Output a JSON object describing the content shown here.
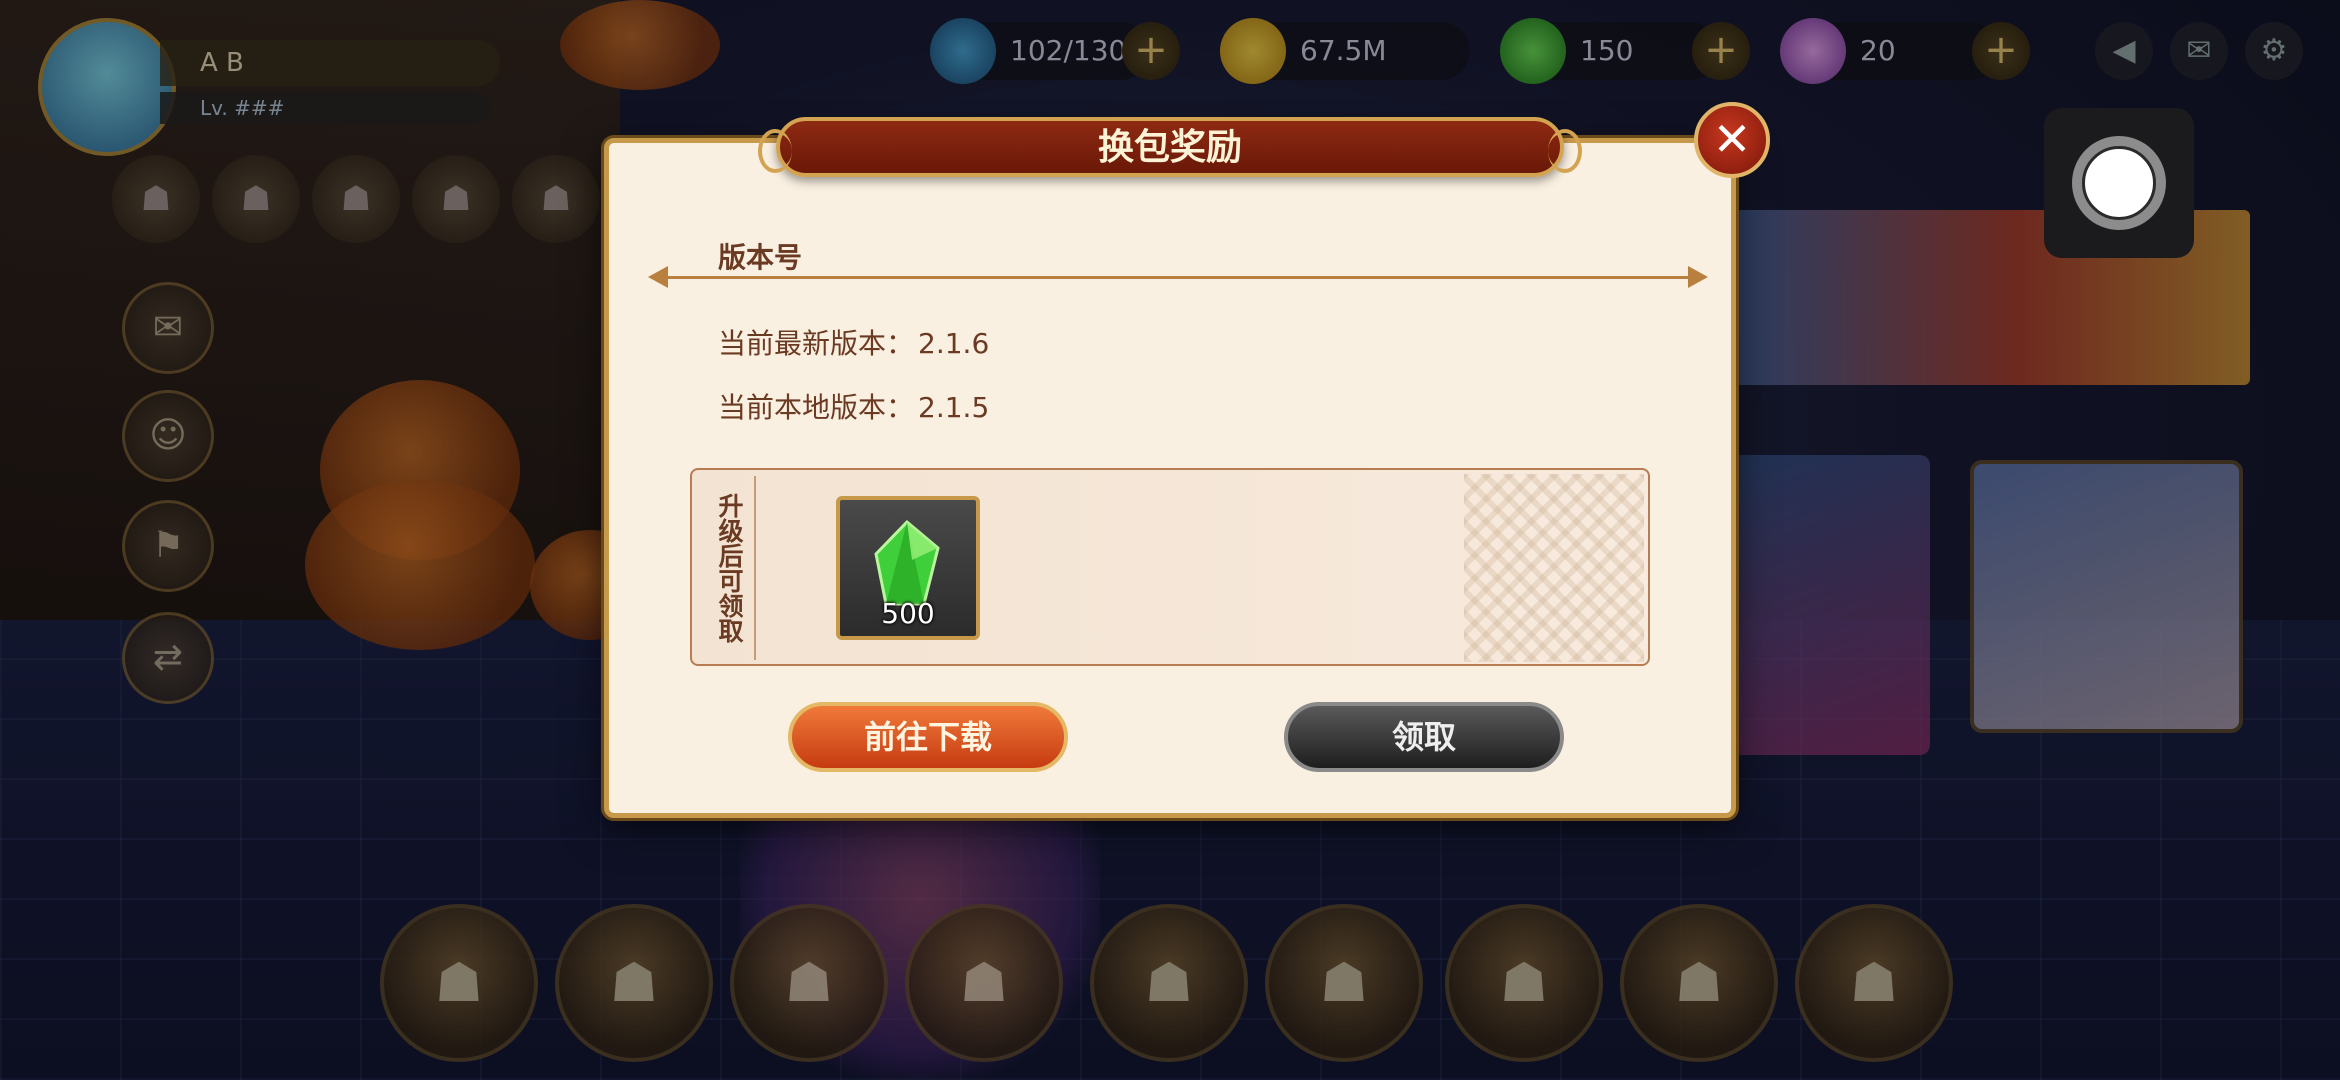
{
  "hud": {
    "player_name": "A B",
    "exp_text": "Lv. ###",
    "stamina": "102/130",
    "gold": "67.5M",
    "gems": "150",
    "crystals": "20"
  },
  "dialog": {
    "title": "换包奖励",
    "section_title": "版本号",
    "latest_version_label": "当前最新版本：",
    "latest_version_value": "2.1.6",
    "local_version_label": "当前本地版本：",
    "local_version_value": "2.1.5",
    "reward_label": "升级后可领取",
    "reward_item": {
      "icon": "green-gem-icon",
      "count": "500"
    },
    "download_button": "前往下载",
    "claim_button": "领取",
    "close_symbol": "✕"
  },
  "colors": {
    "accent_gold": "#c79a4b",
    "title_red": "#8e2a12",
    "text_brown": "#6b3a22"
  }
}
